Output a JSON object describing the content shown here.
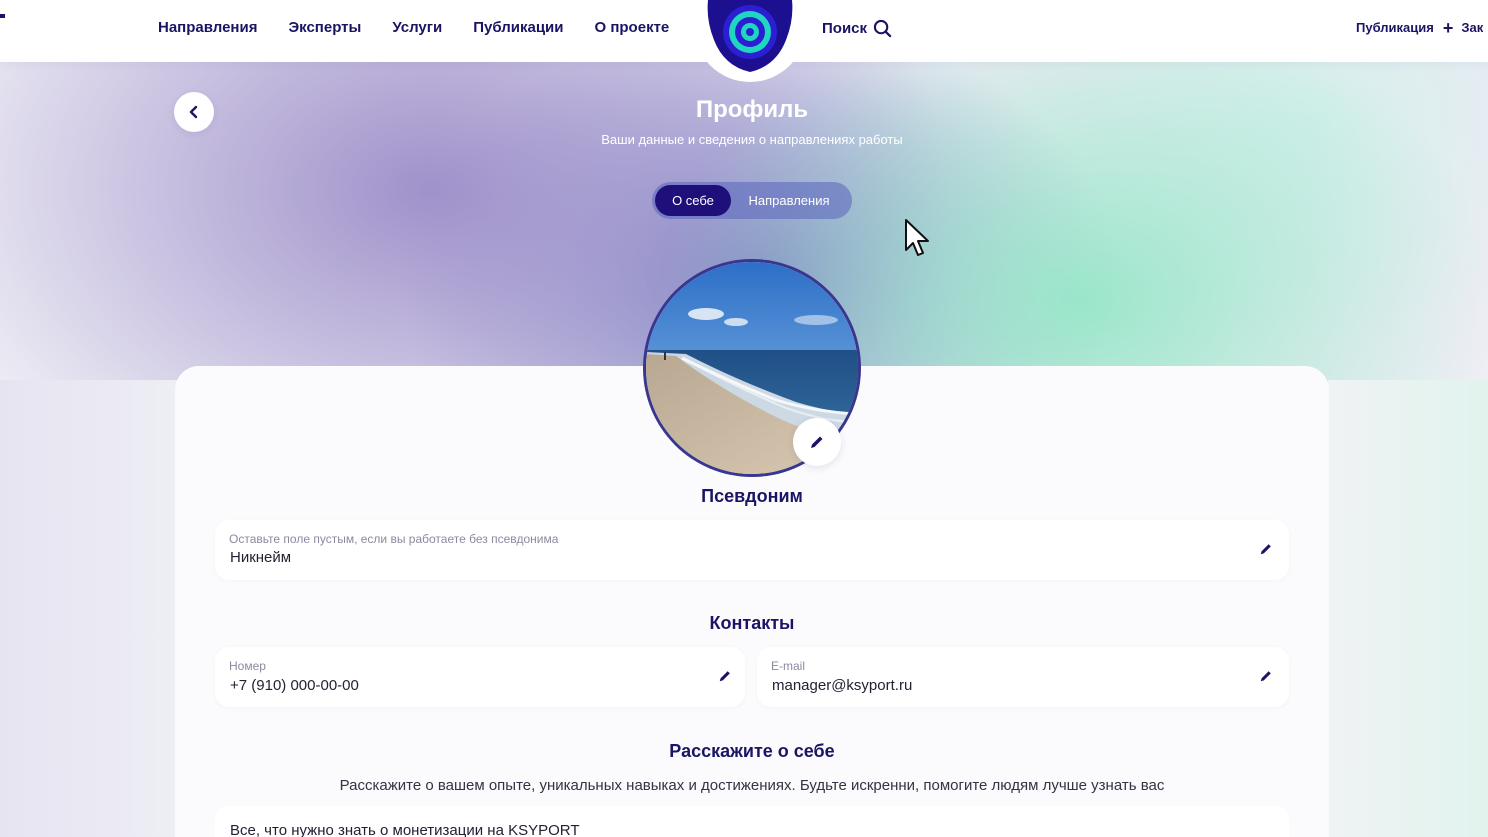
{
  "header": {
    "nav": [
      "Направления",
      "Эксперты",
      "Услуги",
      "Публикации",
      "О проекте"
    ],
    "search_label": "Поиск",
    "publication_label": "Публикация",
    "cut_off_label": "Зак"
  },
  "page": {
    "title": "Профиль",
    "subtitle": "Ваши данные и сведения о направлениях работы",
    "tabs": [
      {
        "label": "О себе",
        "active": true
      },
      {
        "label": "Направления",
        "active": false
      }
    ]
  },
  "pseudonym": {
    "title": "Псевдоним",
    "field_label": "Оставьте поле пустым, если вы работаете без псевдонима",
    "field_value": "Никнейм"
  },
  "contacts": {
    "title": "Контакты",
    "phone_label": "Номер",
    "phone_value": "+7 (910) 000-00-00",
    "email_label": "E-mail",
    "email_value": "manager@ksyport.ru"
  },
  "about": {
    "title": "Расскажите о себе",
    "description": "Расскажите о вашем опыте, уникальных навыках и достижениях. Будьте искренни, помогите людям лучше узнать вас",
    "text_value": "Все, что нужно знать о монетизации на KSYPORT"
  },
  "colors": {
    "primary": "#1b1464",
    "tab_active": "#1e0f7a",
    "logo_blue": "#2a1fd1",
    "logo_teal": "#1ee0c2"
  },
  "icons": [
    "back-chevron-icon",
    "search-icon",
    "plus-icon",
    "pencil-icon",
    "cursor-icon",
    "logo-icon"
  ]
}
